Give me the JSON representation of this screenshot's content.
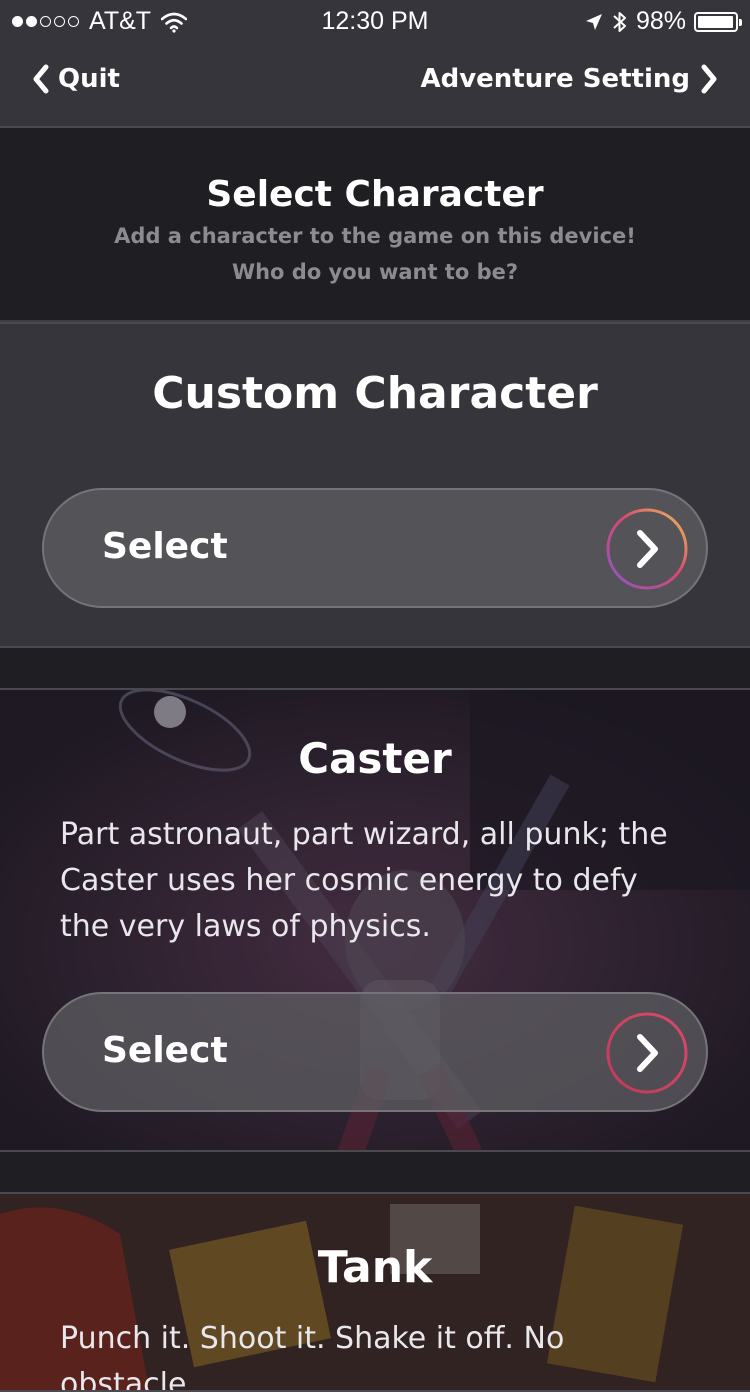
{
  "status_bar": {
    "carrier": "AT&T",
    "time": "12:30 PM",
    "battery": "98%",
    "battery_level": 0.98,
    "signal_bars": 2,
    "icons": [
      "signal-dots-icon",
      "wifi-icon",
      "location-arrow-icon",
      "bluetooth-icon",
      "battery-icon"
    ]
  },
  "nav": {
    "back_label": "Quit",
    "next_label": "Adventure Setting"
  },
  "header": {
    "title": "Select Character",
    "subtitle_line1": "Add a character to the game on this device!",
    "subtitle_line2": "Who do you want to be?"
  },
  "cards": [
    {
      "title": "Custom Character",
      "select_label": "Select"
    },
    {
      "title": "Caster",
      "description": "Part astronaut, part wizard, all punk; the Caster uses her cosmic energy to defy the very laws of physics.",
      "select_label": "Select"
    },
    {
      "title": "Tank",
      "description": "Punch it. Shoot it. Shake it off. No obstacle"
    }
  ],
  "colors": {
    "background": "#1f1e23",
    "bar": "#36353b",
    "ring_gradient": [
      "#e8c45a",
      "#d9486f",
      "#8a56c9"
    ]
  }
}
